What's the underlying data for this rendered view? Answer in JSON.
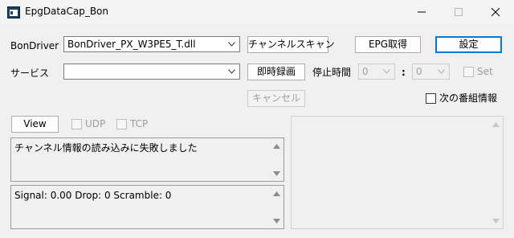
{
  "window": {
    "title": "EpgDataCap_Bon"
  },
  "row1": {
    "bondriver_label": "BonDriver",
    "bondriver_value": "BonDriver_PX_W3PE5_T.dll",
    "channel_scan_button": "チャンネルスキャン",
    "epg_button": "EPG取得",
    "settings_button": "設定"
  },
  "row2": {
    "service_label": "サービス",
    "service_value": "",
    "record_now_button": "即時録画",
    "stop_time_label": "停止時間",
    "hour_value": "0",
    "time_separator": ":",
    "minute_value": "0",
    "set_checkbox": "Set"
  },
  "row3": {
    "cancel_button": "キャンセル",
    "next_program_checkbox": "次の番組情報"
  },
  "row4": {
    "view_button": "View",
    "udp_checkbox": "UDP",
    "tcp_checkbox": "TCP"
  },
  "log": {
    "message": "チャンネル情報の読み込みに失敗しました"
  },
  "status": {
    "text": "Signal: 0.00 Drop: 0 Scramble: 0"
  },
  "colors": {
    "default_button_border": "#0078d7",
    "app_icon": "#1f3f5f"
  }
}
